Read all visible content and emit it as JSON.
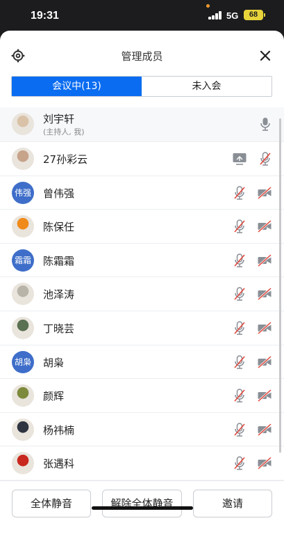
{
  "status_bar": {
    "time": "19:31",
    "network": "5G",
    "battery": "68"
  },
  "header": {
    "title": "管理成员",
    "settings_icon": "gear-icon",
    "close_icon": "close-icon"
  },
  "tabs": [
    {
      "label": "会议中(13)",
      "active": true
    },
    {
      "label": "未入会",
      "active": false
    }
  ],
  "members": [
    {
      "name": "刘宇轩",
      "subtitle": "(主持人, 我)",
      "avatar": "photo",
      "avatar_color": "#d9c2a8",
      "mic": "on",
      "camera": "none",
      "screen_share": false
    },
    {
      "name": "27孙彩云",
      "avatar": "photo",
      "avatar_color": "#c7a38a",
      "mic": "off",
      "camera": "none",
      "screen_share": true
    },
    {
      "name": "曾伟强",
      "avatar": "text",
      "avatar_text": "伟强",
      "mic": "off",
      "camera": "off",
      "screen_share": false
    },
    {
      "name": "陈保任",
      "avatar": "photo",
      "avatar_color": "#f08a1a",
      "mic": "off",
      "camera": "off",
      "screen_share": false
    },
    {
      "name": "陈霜霜",
      "avatar": "text",
      "avatar_text": "霜霜",
      "mic": "off",
      "camera": "off",
      "screen_share": false
    },
    {
      "name": "池泽涛",
      "avatar": "photo",
      "avatar_color": "#b9b4a8",
      "mic": "off",
      "camera": "off",
      "screen_share": false
    },
    {
      "name": "丁晓芸",
      "avatar": "photo",
      "avatar_color": "#5a7152",
      "mic": "off",
      "camera": "off",
      "screen_share": false
    },
    {
      "name": "胡枭",
      "avatar": "text",
      "avatar_text": "胡枭",
      "mic": "off",
      "camera": "off",
      "screen_share": false
    },
    {
      "name": "颜辉",
      "avatar": "photo",
      "avatar_color": "#7d8a3c",
      "mic": "off",
      "camera": "off",
      "screen_share": false
    },
    {
      "name": "杨祎楠",
      "avatar": "photo",
      "avatar_color": "#2e3440",
      "mic": "off",
      "camera": "off",
      "screen_share": false
    },
    {
      "name": "张遇科",
      "avatar": "photo",
      "avatar_color": "#c8281e",
      "mic": "off",
      "camera": "off",
      "screen_share": false
    }
  ],
  "footer": {
    "mute_all": "全体静音",
    "unmute_all": "解除全体静音",
    "invite": "邀请"
  },
  "colors": {
    "accent": "#0a6cf0",
    "text_avatar": "#3e6ec9",
    "muted_red": "#e0453a",
    "icon_gray": "#8a8f96"
  }
}
